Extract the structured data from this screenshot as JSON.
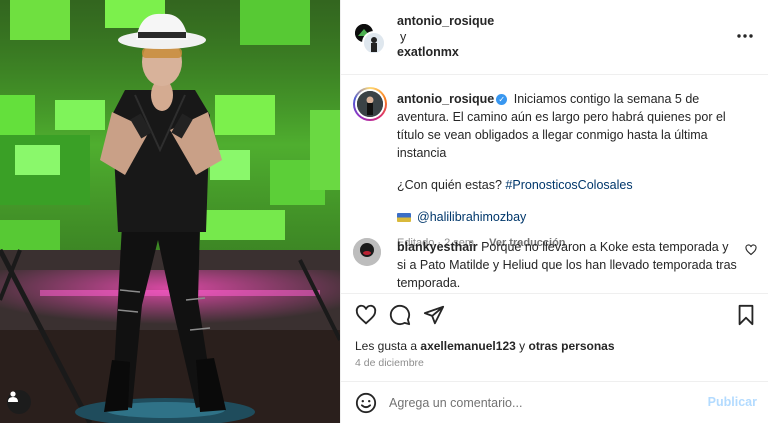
{
  "header": {
    "user1": "antonio_rosique",
    "connector": "y",
    "user2": "exatlonmx"
  },
  "caption": {
    "username": "antonio_rosique",
    "text": "Iniciamos contigo la semana 5 de aventura. El camino aún es largo pero habrá quienes por el título se vean obligados a llegar conmigo hasta la última instancia",
    "question": "¿Con quién estas?",
    "hashtag": "#PronosticosColosales",
    "mention": "@halilibrahimozbay",
    "edited": "Editado · 2 sem",
    "translate": "Ver traducción"
  },
  "comment": {
    "username": "blankyesthair",
    "text": "Porqué no llevaron a Koke esta temporada y si a Pato Matilde y Heliud que los han llevado temporada tras temporada."
  },
  "likes": {
    "prefix": "Les gusta a",
    "user": "axellemanuel123",
    "middle": "y",
    "others": "otras personas"
  },
  "date": "4 de diciembre",
  "add_comment": {
    "placeholder": "Agrega un comentario...",
    "publish": "Publicar"
  },
  "icons": {
    "more": "more-horizontal-icon",
    "like": "heart-icon",
    "comment": "comment-bubble-icon",
    "share": "paper-plane-icon",
    "save": "bookmark-icon",
    "emoji": "smiley-icon",
    "tags": "user-tag-icon",
    "verified": "verified-badge-icon"
  },
  "colors": {
    "link": "#00376b",
    "verified": "#3897f0",
    "muted": "#8e8e8e",
    "publish_disabled": "#b3dbff"
  }
}
